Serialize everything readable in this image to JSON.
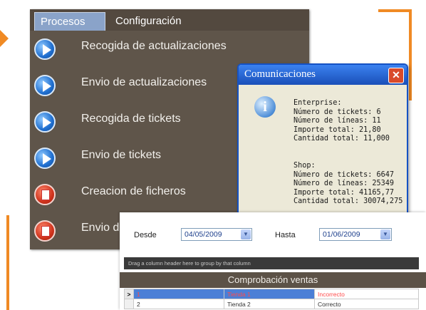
{
  "menu": {
    "tabs": [
      "Procesos",
      "Configuración"
    ],
    "items": [
      {
        "label": "Recogida de actualizaciones",
        "icon": "play-icon"
      },
      {
        "label": "Envio de actualizaciones",
        "icon": "play-icon"
      },
      {
        "label": "Recogida de tickets",
        "icon": "play-icon"
      },
      {
        "label": "Envio de tickets",
        "icon": "play-icon"
      },
      {
        "label": "Creacion de ficheros",
        "icon": "file-icon"
      },
      {
        "label": "Envio d",
        "icon": "file-icon"
      }
    ]
  },
  "dialog": {
    "title": "Comunicaciones",
    "close_glyph": "✕",
    "icon_glyph": "i",
    "enterprise_text": "Enterprise:\nNúmero de tickets: 6\nNúmero de líneas: 11\nImporte total: 21,80\nCantidad total: 11,000",
    "shop_text": "Shop:\nNúmero de tickets: 6647\nNúmero de líneas: 25349\nImporte total: 41165,77\nCantidad total: 30074,275"
  },
  "filters": {
    "from_label": "Desde",
    "from_value": "04/05/2009",
    "to_label": "Hasta",
    "to_value": "01/06/2009",
    "dropdown_glyph": "▼"
  },
  "grid": {
    "group_hint": "Drag a column header here to group by that column",
    "title": "Comprobación ventas",
    "rows": [
      {
        "indicator": ">",
        "num": "1",
        "store": "Tienda 1",
        "status": "Incorrecto"
      },
      {
        "indicator": "",
        "num": "2",
        "store": "Tienda 2",
        "status": "Correcto"
      }
    ]
  },
  "colors": {
    "accent": "#f08a24",
    "menu_bg": "#5f554a",
    "title_bar": "#1a4fb8",
    "error": "#e0302a"
  }
}
